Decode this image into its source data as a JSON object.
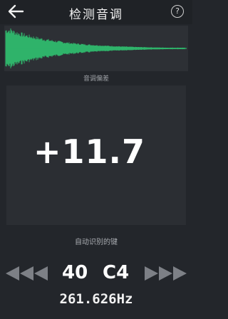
{
  "header": {
    "title": "检测音调",
    "back_icon": "back-arrow-icon",
    "help_label": "?"
  },
  "waveform": {
    "color": "#2fb36a"
  },
  "deviation": {
    "label": "音调偏差",
    "value": "+11.7"
  },
  "key": {
    "label": "自动识别的键",
    "number": "40",
    "note": "C4",
    "frequency": "261.626Hz",
    "prev_icon": "triple-left-arrow-icon",
    "next_icon": "triple-right-arrow-icon"
  }
}
